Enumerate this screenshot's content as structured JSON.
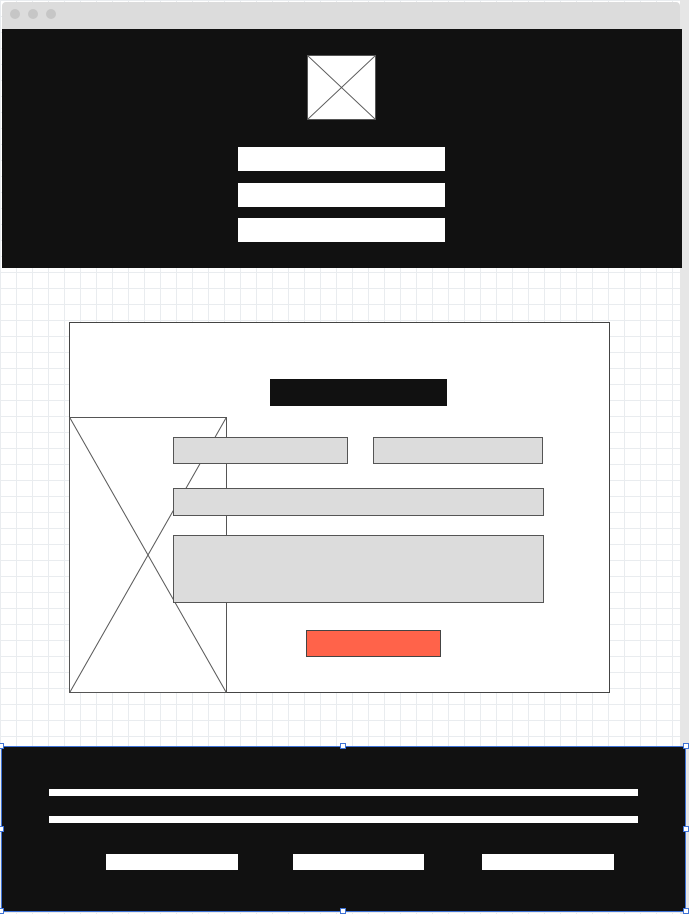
{
  "window": {
    "controls": [
      "close-dot",
      "minimize-dot",
      "maximize-dot"
    ]
  },
  "colors": {
    "canvas_bg": "#ffffff",
    "grid_line": "#e9ecef",
    "header_bg": "#111111",
    "footer_bg": "#111111",
    "field_fill": "#dcdcdc",
    "submit_fill": "#ff634a",
    "selection_outline": "#3f73d6"
  },
  "header": {
    "logo_icon": "image-placeholder-icon",
    "nav_item_count": 3
  },
  "form_card": {
    "image_icon": "image-placeholder-icon",
    "inputs": [
      "first-name-field",
      "last-name-field",
      "email-field",
      "message-field"
    ]
  },
  "footer": {
    "selected": true,
    "text_line_count": 2,
    "link_count": 3
  }
}
